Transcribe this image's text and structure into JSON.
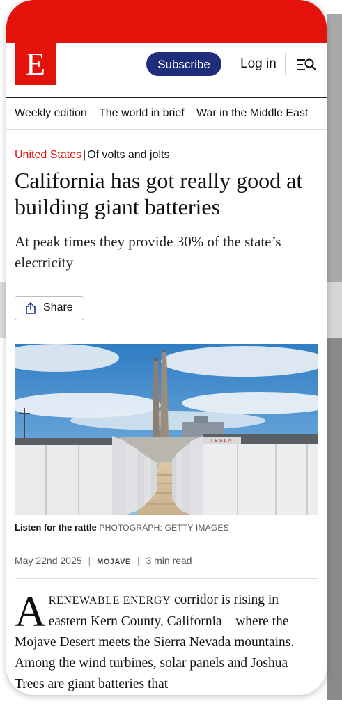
{
  "brand": {
    "logo_letter": "E",
    "red": "#e3120b",
    "navy": "#1f2e7a"
  },
  "header": {
    "subscribe_label": "Subscribe",
    "login_label": "Log in",
    "menu_icon": "menu-search-icon"
  },
  "nav": {
    "items": [
      "Weekly edition",
      "The world in brief",
      "War in the Middle East"
    ]
  },
  "article": {
    "section": "United States",
    "topic": "Of volts and jolts",
    "headline": "California has got really good at building giant batteries",
    "subhead": "At peak times they provide 30% of the state’s electricity",
    "share_label": "Share",
    "image": {
      "caption": "Listen for the rattle",
      "credit": "PHOTOGRAPH: GETTY IMAGES",
      "container_brand": "TESLA"
    },
    "date": "May 22nd 2025",
    "location": "MOJAVE",
    "read_time": "3 min read",
    "body": {
      "dropcap": "A",
      "smallcaps": "RENEWABLE ENERGY",
      "text": " corridor is rising in eastern Kern County, California—where the Mojave Desert meets the Sierra Nevada mountains. Among the wind turbines, solar panels and Joshua Trees are giant batteries that"
    }
  }
}
